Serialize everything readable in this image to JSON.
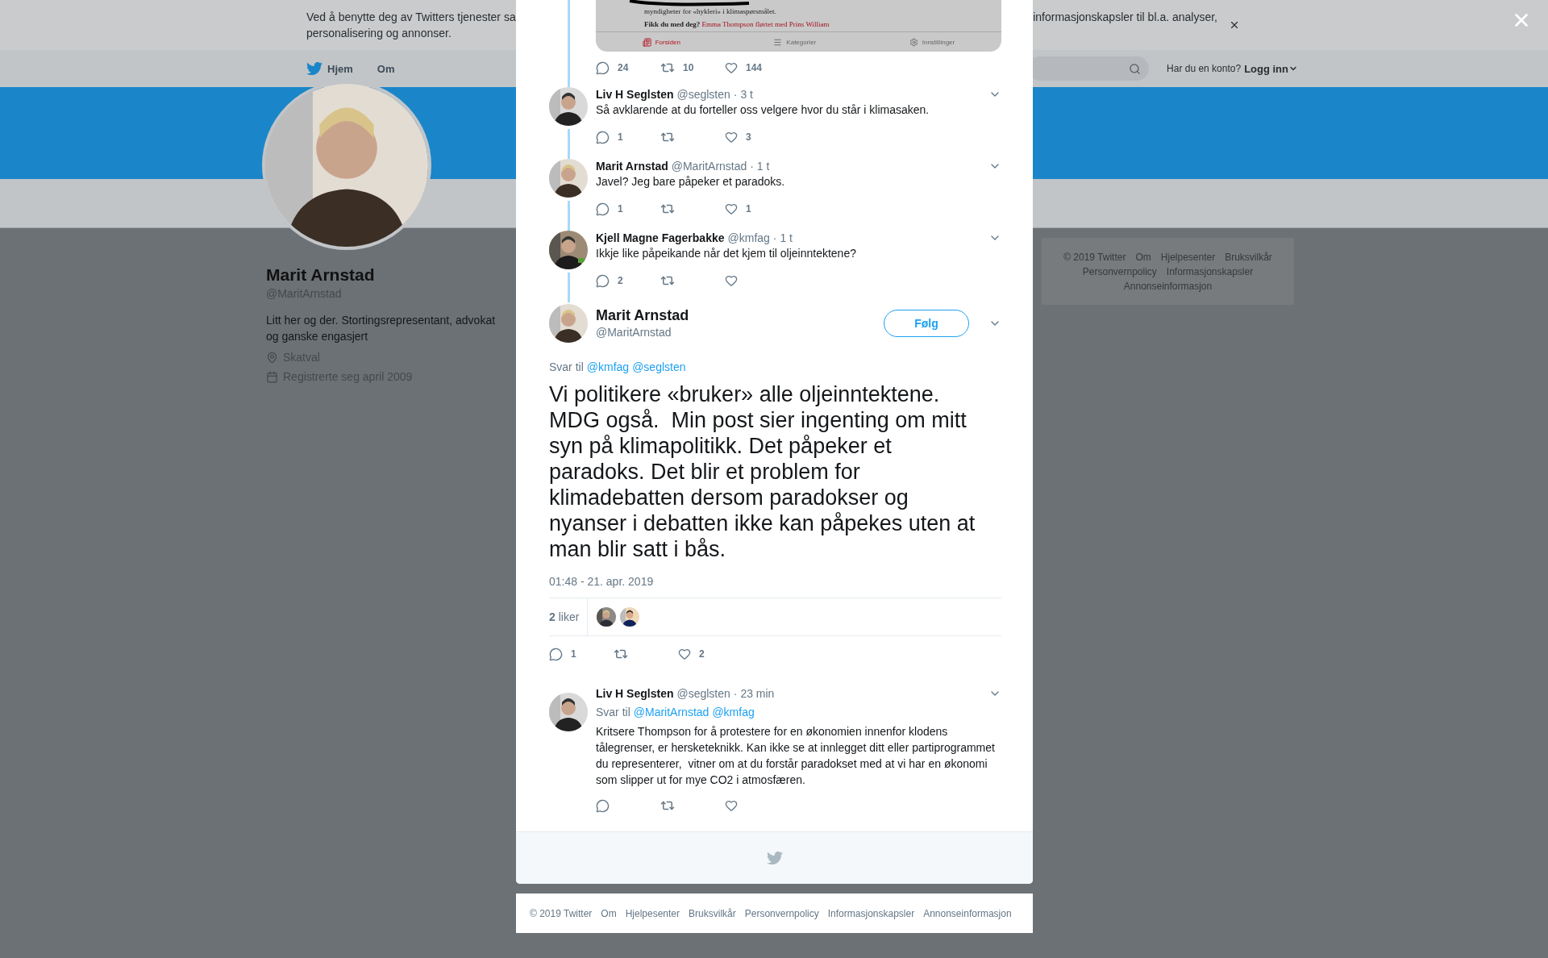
{
  "cookie_banner": {
    "line_1_left": "Ved å benytte deg av Twitters tjenester sa",
    "line_1_right": "informasjonskapsler til bl.a. analyser,",
    "line_2": "personalisering og annonser."
  },
  "nav": {
    "items": [
      "Hjem",
      "Om"
    ],
    "account_prompt": "Har du en konto?",
    "login": "Logg inn"
  },
  "profile": {
    "name": "Marit Arnstad",
    "handle": "@MaritArnstad",
    "bio": "Litt her og der. Stortingsrepresentant, advokat og ganske engasjert",
    "location": "Skatval",
    "joined": "Registrerte seg april 2009"
  },
  "side_footer": {
    "links": [
      "© 2019 Twitter",
      "Om",
      "Hjelpesenter",
      "Bruksvilkår",
      "Personvernpolicy",
      "Informasjonskapsler",
      "Annonseinformasjon"
    ]
  },
  "dialog": {
    "embedded_article": {
      "line": "myndigheter for «hykleri» i klimaspørsmålet.",
      "teaser_label": "Fikk du med deg?",
      "teaser_link": "Emma Thompson flørtet med Prins William",
      "tabs": [
        {
          "label": "Forsiden",
          "selected": true
        },
        {
          "label": "Kategorier",
          "selected": false
        },
        {
          "label": "Innstillinger",
          "selected": false
        }
      ]
    },
    "quoted_stats": {
      "replies": "24",
      "retweets": "10",
      "likes": "144"
    },
    "thread": [
      {
        "name": "Liv H Seglsten",
        "handle": "@seglsten",
        "time": "· 3 t",
        "text": "Så avklarende at du forteller oss velgere hvor du står i klimasaken.",
        "replies": "1",
        "likes": "3"
      },
      {
        "name": "Marit Arnstad",
        "handle": "@MaritArnstad",
        "time": "· 1 t",
        "text": "Javel? Jeg bare påpeker et paradoks.",
        "replies": "1",
        "likes": "1"
      },
      {
        "name": "Kjell Magne Fagerbakke",
        "handle": "@kmfag",
        "time": "· 1 t",
        "text": "Ikkje like påpeikande når det kjem til oljeinntektene?",
        "replies": "2"
      }
    ],
    "main_tweet": {
      "name": "Marit Arnstad",
      "handle": "@MaritArnstad",
      "follow": "Følg",
      "reply_to_label": "Svar til",
      "reply_to": [
        "@kmfag",
        "@seglsten"
      ],
      "text": "Vi politikere «bruker» alle oljeinntektene. MDG også.  Min post sier ingenting om mitt syn på klimapolitikk. Det påpeker et paradoks. Det blir et problem for klimadebatten dersom paradokser og nyanser i debatten ikke kan påpekes uten at man blir satt i bås.",
      "timestamp": "01:48 - 21. apr. 2019",
      "likes_summary": "**2** liker",
      "likers": [
        {
          "kind": "picture"
        },
        {
          "kind": "picture"
        }
      ],
      "replies": "1",
      "likes": "2"
    },
    "replies": [
      {
        "name": "Liv H Seglsten",
        "handle": "@seglsten",
        "time": "· 23 min",
        "reply_to_label": "Svar til",
        "reply_to": [
          "@MaritArnstad",
          "@kmfag"
        ],
        "text": "Kritsere Thompson for å protestere for en økonomien innenfor klodens tålegrenser, er hersketeknikk. Kan ikke se at innlegget ditt eller partiprogrammet du representerer,  vitner om at du forstår paradokset med at vi har en økonomi som slipper ut for mye CO2 i atmosfæren."
      }
    ]
  },
  "footer": {
    "links": [
      "© 2019 Twitter",
      "Om",
      "Hjelpesenter",
      "Bruksvilkår",
      "Personvernpolicy",
      "Informasjonskapsler",
      "Annonseinformasjon"
    ]
  }
}
